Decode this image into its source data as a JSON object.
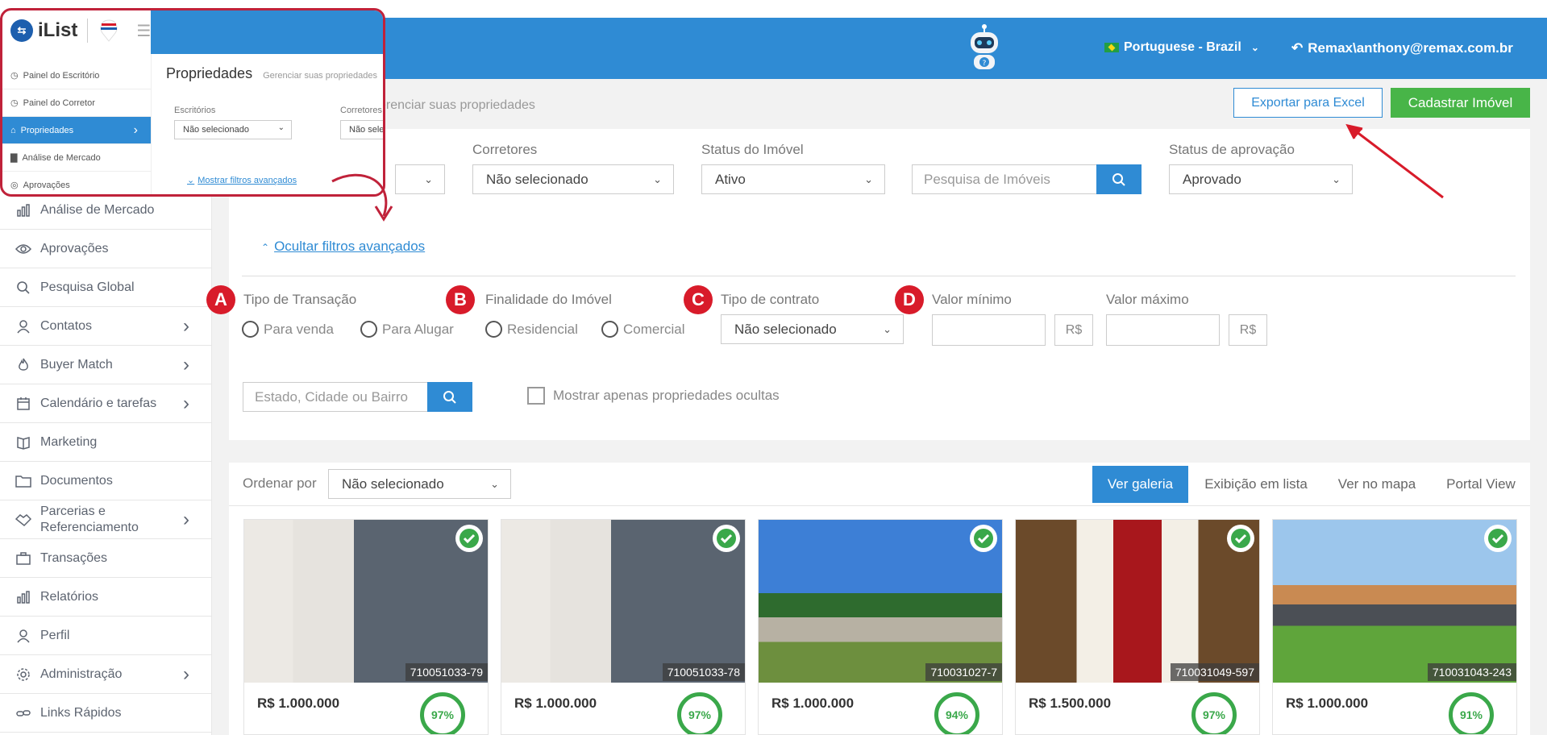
{
  "header": {
    "language": "Portuguese - Brazil",
    "user": "Remax\\anthony@remax.com.br"
  },
  "sidebar": {
    "items": [
      {
        "label": "Análise de Mercado",
        "icon": "bar-chart-icon",
        "chevron": false
      },
      {
        "label": "Aprovações",
        "icon": "eye-icon",
        "chevron": false
      },
      {
        "label": "Pesquisa Global",
        "icon": "search-icon",
        "chevron": false
      },
      {
        "label": "Contatos",
        "icon": "contacts-icon",
        "chevron": true
      },
      {
        "label": "Buyer Match",
        "icon": "flame-icon",
        "chevron": true
      },
      {
        "label": "Calendário e tarefas",
        "icon": "calendar-icon",
        "chevron": true
      },
      {
        "label": "Marketing",
        "icon": "book-icon",
        "chevron": false
      },
      {
        "label": "Documentos",
        "icon": "folder-icon",
        "chevron": false
      },
      {
        "label": "Parcerias e Referenciamento",
        "icon": "handshake-icon",
        "chevron": true
      },
      {
        "label": "Transações",
        "icon": "briefcase-icon",
        "chevron": false
      },
      {
        "label": "Relatórios",
        "icon": "report-icon",
        "chevron": false
      },
      {
        "label": "Perfil",
        "icon": "user-icon",
        "chevron": false
      },
      {
        "label": "Administração",
        "icon": "gear-icon",
        "chevron": true
      },
      {
        "label": "Links Rápidos",
        "icon": "link-icon",
        "chevron": false
      }
    ]
  },
  "page": {
    "subtitle": "erenciar suas propriedades",
    "export_label": "Exportar para Excel",
    "create_label": "Cadastrar Imóvel"
  },
  "filters": {
    "brokers_label": "Corretores",
    "brokers_value": "Não selecionado",
    "status_label": "Status do Imóvel",
    "status_value": "Ativo",
    "search_placeholder": "Pesquisa de Imóveis",
    "approval_label": "Status de aprovação",
    "approval_value": "Aprovado",
    "hide_advanced": "Ocultar filtros avançados",
    "transaction_label": "Tipo de Transação",
    "sale": "Para venda",
    "rent": "Para Alugar",
    "purpose_label": "Finalidade do Imóvel",
    "residential": "Residencial",
    "commercial": "Comercial",
    "contract_label": "Tipo de contrato",
    "contract_value": "Não selecionado",
    "min_label": "Valor mínimo",
    "max_label": "Valor máximo",
    "currency": "R$",
    "location_placeholder": "Estado, Cidade ou Bairro",
    "hidden_only": "Mostrar apenas propriedades ocultas",
    "badges": [
      "A",
      "B",
      "C",
      "D"
    ]
  },
  "results": {
    "order_label": "Ordenar por",
    "order_value": "Não selecionado",
    "views": [
      "Ver galeria",
      "Exibição em lista",
      "Ver no mapa",
      "Portal View"
    ],
    "cards": [
      {
        "code": "710051033-79",
        "price": "R$ 1.000.000",
        "score": "97%"
      },
      {
        "code": "710051033-78",
        "price": "R$ 1.000.000",
        "score": "97%"
      },
      {
        "code": "710031027-7",
        "price": "R$ 1.000.000",
        "score": "94%"
      },
      {
        "code": "710031049-597",
        "price": "R$ 1.500.000",
        "score": "97%"
      },
      {
        "code": "710031043-243",
        "price": "R$ 1.000.000",
        "score": "91%"
      }
    ]
  },
  "inset": {
    "logo_text": "iList",
    "title": "Propriedades",
    "subtitle": "Gerenciar suas propriedades",
    "offices_label": "Escritórios",
    "offices_value": "Não selecionado",
    "brokers_label": "Corretores",
    "brokers_value": "Não sele",
    "advanced_link": "Mostrar filtros avançados",
    "menu": [
      {
        "label": "Painel do Escritório"
      },
      {
        "label": "Painel do Corretor"
      },
      {
        "label": "Propriedades"
      },
      {
        "label": "Análise de Mercado"
      },
      {
        "label": "Aprovações"
      }
    ]
  },
  "colors": {
    "primary": "#2f8bd4",
    "success": "#48b548",
    "annotation": "#c0223a"
  }
}
